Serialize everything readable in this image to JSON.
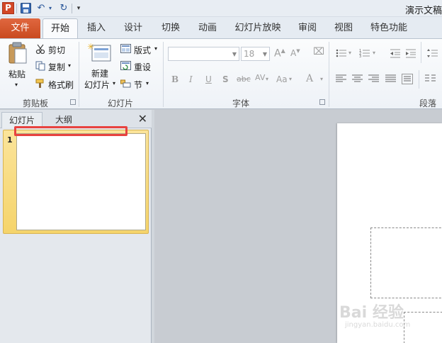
{
  "window": {
    "title": "演示文稿"
  },
  "app_icon_letter": "P",
  "tabs": [
    {
      "label": "文件",
      "active": false
    },
    {
      "label": "开始",
      "active": true
    },
    {
      "label": "插入",
      "active": false
    },
    {
      "label": "设计",
      "active": false
    },
    {
      "label": "切换",
      "active": false
    },
    {
      "label": "动画",
      "active": false
    },
    {
      "label": "幻灯片放映",
      "active": false
    },
    {
      "label": "审阅",
      "active": false
    },
    {
      "label": "视图",
      "active": false
    },
    {
      "label": "特色功能",
      "active": false
    }
  ],
  "ribbon": {
    "clipboard": {
      "label": "剪贴板",
      "paste": "粘贴",
      "cut": "剪切",
      "copy": "复制",
      "format_painter": "格式刷"
    },
    "slides": {
      "label": "幻灯片",
      "new_slide_1": "新建",
      "new_slide_2": "幻灯片",
      "layout": "版式",
      "reset": "重设",
      "section": "节"
    },
    "font": {
      "label": "字体",
      "font_name": "",
      "font_size": "18",
      "bold": "B",
      "italic": "I",
      "underline": "U",
      "shadow": "S",
      "strike": "abc",
      "spacing": "AV",
      "case": "Aa",
      "color": "A"
    },
    "paragraph": {
      "label": "段落"
    }
  },
  "panel": {
    "tabs": [
      "幻灯片",
      "大纲"
    ],
    "close": "✕",
    "slide_number": "1"
  },
  "watermark": {
    "brand": "Bai 经验",
    "url": "jingyan.baidu.com"
  },
  "colors": {
    "file_tab": "#d24726",
    "annotation": "#e8433f",
    "selected_thumb": "#f5d46b"
  }
}
